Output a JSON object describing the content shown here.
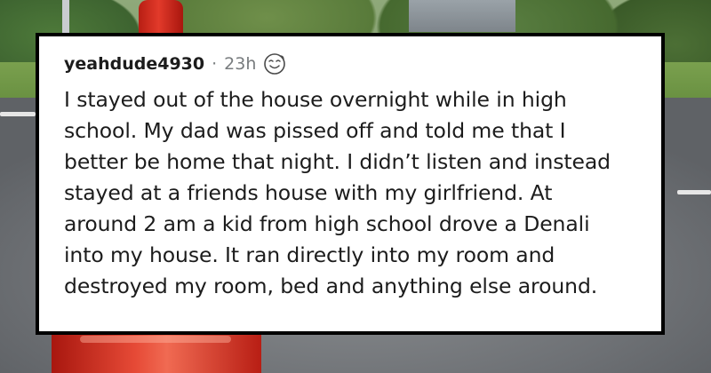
{
  "comment": {
    "username": "yeahdude4930",
    "separator": "·",
    "time": "23h",
    "award_icon": "emoji-award-icon",
    "body_lines": [
      "I stayed out of the house overnight while in high",
      "school. My dad was pissed off and told me that I",
      "better be home that night. I didn’t listen and instead",
      "stayed at a friends house with my girlfriend. At",
      "around 2 am a kid from high school drove a Denali",
      "into my house. It ran directly into my room and",
      "destroyed my room, bed and anything else around."
    ]
  },
  "colors": {
    "card_background": "#ffffff",
    "card_border": "#000000",
    "text": "#1c1c1c",
    "meta_gray": "#787c7e"
  }
}
